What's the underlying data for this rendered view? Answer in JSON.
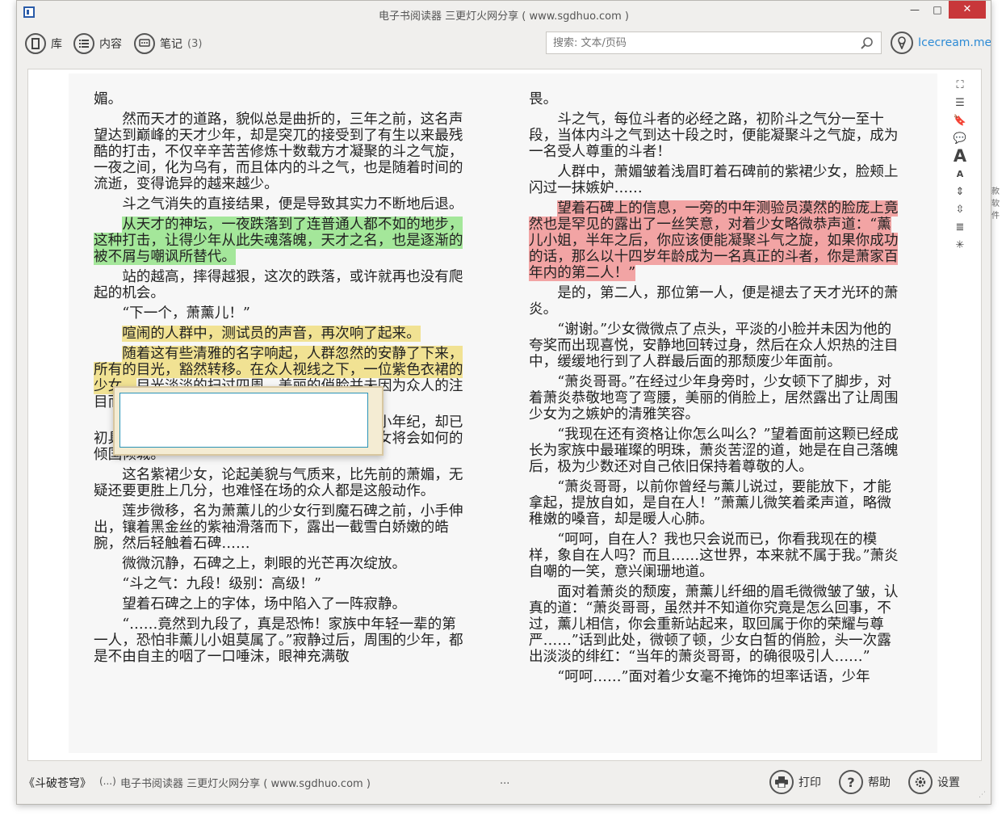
{
  "window": {
    "title": "电子书阅读器 三更灯火网分享 ( www.sgdhuo.com )",
    "min_glyph": "—",
    "max_glyph": "□",
    "close_glyph": "✕"
  },
  "toolbar": {
    "library_label": "库",
    "toc_label": "内容",
    "notes_label": "笔记",
    "notes_count": "(3)",
    "search_placeholder": "搜索: 文本/页码",
    "brand_label": "Icecream.me"
  },
  "reader": {
    "left_paragraphs": [
      {
        "segments": [
          {
            "text": "媚。",
            "hl": ""
          }
        ],
        "indent": false
      },
      {
        "segments": [
          {
            "text": "然而天才的道路，貌似总是曲折的，三年之前，这名声望达到巅峰的天才少年，却是突兀的接受到了有生以来最残酷的打击，不仅辛辛苦苦修炼十数载方才凝聚的斗之气旋，一夜之间，化为乌有，而且体内的斗之气，也是随着时间的流逝，变得诡异的越来越少。",
            "hl": ""
          }
        ],
        "indent": true
      },
      {
        "segments": [
          {
            "text": "斗之气消失的直接结果，便是导致其实力不断地后退。",
            "hl": ""
          }
        ],
        "indent": true
      },
      {
        "segments": [
          {
            "text": "从天才的神坛，一夜跌落到了连普通人都不如的地步，这种打击，让得少年从此失魂落魄，天才之名，也是逐渐的被不屑与嘲讽所替代。",
            "hl": "green"
          }
        ],
        "indent": true
      },
      {
        "segments": [
          {
            "text": "站的越高，摔得越狠，这次的跌落，或许就再也没有爬起的机会。",
            "hl": ""
          }
        ],
        "indent": true
      },
      {
        "segments": [
          {
            "text": "“下一个，萧薰儿！”",
            "hl": ""
          }
        ],
        "indent": true
      },
      {
        "segments": [
          {
            "text": "喧闹的人群中，测试员的声音，再次响了起来。",
            "hl": "yellow"
          }
        ],
        "indent": true
      },
      {
        "segments": [
          {
            "text": "随着这有些清雅的名字响起，人群忽然的安静了下来，所有的目光，豁然转移。在众人视线之下，一位紫色衣裙的少女，",
            "hl": "yellow"
          },
          {
            "text": "目光淡淡的扫过四周，美丽的俏脸并未因为众人的注目而改变分毫。",
            "hl": ""
          }
        ],
        "indent": true
      },
      {
        "segments": [
          {
            "text": "少女清冷淡然的气质，犹如清莲初绽，小小年纪，却已初具脱俗气质，难以想象，日后若是长大，少女将会如何的倾国倾城。",
            "hl": ""
          }
        ],
        "indent": true
      },
      {
        "segments": [
          {
            "text": "这名紫裙少女，论起美貌与气质来，比先前的萧媚，无疑还要更胜上几分，也难怪在场的众人都是这般动作。",
            "hl": ""
          }
        ],
        "indent": true
      },
      {
        "segments": [
          {
            "text": "莲步微移，名为萧薰儿的少女行到魔石碑之前，小手伸出，镶着黑金丝的紫袖滑落而下，露出一截雪白娇嫩的皓腕，然后轻触着石碑……",
            "hl": ""
          }
        ],
        "indent": true
      },
      {
        "segments": [
          {
            "text": "微微沉静，石碑之上，刺眼的光芒再次绽放。",
            "hl": ""
          }
        ],
        "indent": true
      },
      {
        "segments": [
          {
            "text": "“斗之气：九段！级别：高级！”",
            "hl": ""
          }
        ],
        "indent": true
      },
      {
        "segments": [
          {
            "text": "望着石碑之上的字体，场中陷入了一阵寂静。",
            "hl": ""
          }
        ],
        "indent": true
      },
      {
        "segments": [
          {
            "text": "“……竟然到九段了，真是恐怖！家族中年轻一辈的第一人，恐怕非薰儿小姐莫属了。”寂静过后，周围的少年，都是不由自主的咽了一口唾沫，眼神充满敬",
            "hl": ""
          }
        ],
        "indent": true
      }
    ],
    "right_paragraphs": [
      {
        "segments": [
          {
            "text": "畏。",
            "hl": ""
          }
        ],
        "indent": false
      },
      {
        "segments": [
          {
            "text": "斗之气，每位斗者的必经之路，初阶斗之气分一至十段，当体内斗之气到达十段之时，便能凝聚斗之气旋，成为一名受人尊重的斗者！",
            "hl": ""
          }
        ],
        "indent": true
      },
      {
        "segments": [
          {
            "text": "人群中，萧媚皱着浅眉盯着石碑前的紫裙少女，脸颊上闪过一抹嫉妒……",
            "hl": ""
          }
        ],
        "indent": true
      },
      {
        "segments": [
          {
            "text": "望着石碑上的信息，一旁的中年测验员漠然的脸庞上竟然也是罕见的露出了一丝笑意，对着少女略微恭声道：“薰儿小姐，半年之后，你应该便能凝聚斗气之旋，如果你成功的话，那么以十四岁年龄成为一名真正的斗者，你是萧家百年内的第二人！”",
            "hl": "red"
          }
        ],
        "indent": true
      },
      {
        "segments": [
          {
            "text": "是的，第二人，那位第一人，便是褪去了天才光环的萧炎。",
            "hl": ""
          }
        ],
        "indent": true
      },
      {
        "segments": [
          {
            "text": "“谢谢。”少女微微点了点头，平淡的小脸并未因为他的夸奖而出现喜悦，安静地回转过身，然后在众人炽热的注目中，缓缓地行到了人群最后面的那颓废少年面前。",
            "hl": ""
          }
        ],
        "indent": true
      },
      {
        "segments": [
          {
            "text": "“萧炎哥哥。”在经过少年身旁时，少女顿下了脚步，对着萧炎恭敬地弯了弯腰，美丽的俏脸上，居然露出了让周围少女为之嫉妒的清雅笑容。",
            "hl": ""
          }
        ],
        "indent": true
      },
      {
        "segments": [
          {
            "text": "“我现在还有资格让你怎么叫么？”望着面前这颗已经成长为家族中最璀璨的明珠，萧炎苦涩的道，她是在自己落魄后，极为少数还对自己依旧保持着尊敬的人。",
            "hl": ""
          }
        ],
        "indent": true
      },
      {
        "segments": [
          {
            "text": "“萧炎哥哥，以前你曾经与薰儿说过，要能放下，才能拿起，提放自如，是自在人！”萧薰儿微笑着柔声道，略微稚嫩的嗓音，却是暖人心肺。",
            "hl": ""
          }
        ],
        "indent": true
      },
      {
        "segments": [
          {
            "text": "“呵呵，自在人？我也只会说而已，你看我现在的模样，象自在人吗？而且……这世界，本来就不属于我。”萧炎自嘲的一笑，意兴阑珊地道。",
            "hl": ""
          }
        ],
        "indent": true
      },
      {
        "segments": [
          {
            "text": "面对着萧炎的颓废，萧薰儿纤细的眉毛微微皱了皱，认真的道：“萧炎哥哥，虽然并不知道你究竟是怎么回事，不过，薰儿相信，你会重新站起来，取回属于你的荣耀与尊严……”话到此处，微顿了顿，少女白皙的俏脸，头一次露出淡淡的绯红：“当年的萧炎哥哥，的确很吸引人……”",
            "hl": ""
          }
        ],
        "indent": true
      },
      {
        "segments": [
          {
            "text": "“呵呵……”面对着少女毫不掩饰的坦率话语，少年",
            "hl": ""
          }
        ],
        "indent": true
      }
    ]
  },
  "sidebar_tools": [
    {
      "name": "fullscreen-icon",
      "glyph": "⛶"
    },
    {
      "name": "toc-list-icon",
      "glyph": "☰"
    },
    {
      "name": "bookmark-icon",
      "glyph": "🔖"
    },
    {
      "name": "notes-icon",
      "glyph": "💬"
    },
    {
      "name": "font-increase-icon",
      "glyph": "A"
    },
    {
      "name": "font-decrease-icon",
      "glyph": "A"
    },
    {
      "name": "line-spacing-increase-icon",
      "glyph": "⇕"
    },
    {
      "name": "line-spacing-decrease-icon",
      "glyph": "⇳"
    },
    {
      "name": "justify-icon",
      "glyph": "≣"
    },
    {
      "name": "brightness-icon",
      "glyph": "✳"
    }
  ],
  "note_popup": {
    "value": ""
  },
  "statusbar": {
    "book_title": "《斗破苍穹》",
    "sep": "(...)",
    "app_info": "电子书阅读器 三更灯火网分享 ( www.sgdhuo.com )",
    "dots": "...",
    "print_label": "打印",
    "help_label": "帮助",
    "settings_label": "设置"
  },
  "background": {
    "fragment": "款软件"
  },
  "colors": {
    "highlight_green": "#a4e79a",
    "highlight_yellow": "#f1e293",
    "highlight_red": "#f2a4a4",
    "close_button": "#c8373a",
    "brand": "#2d8bd5"
  }
}
